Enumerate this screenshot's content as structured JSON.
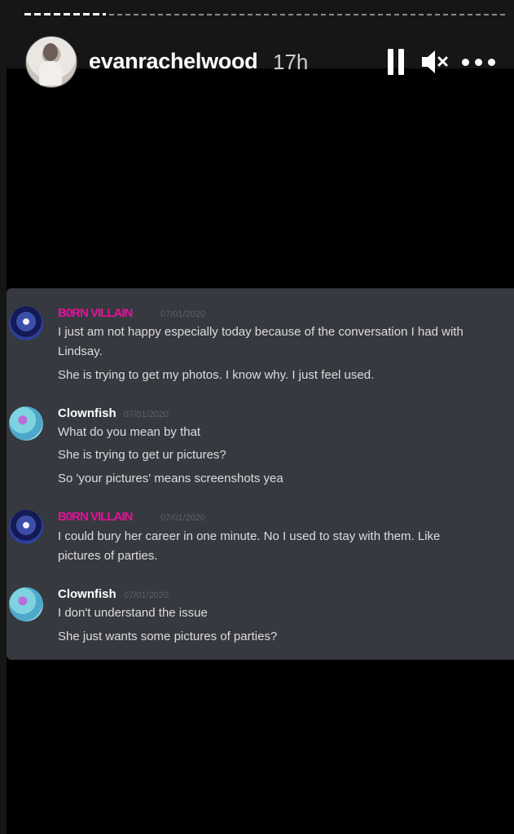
{
  "story": {
    "username": "evanrachelwood",
    "time_ago": "17h",
    "controls": {
      "pause": "pause-icon",
      "mute": "volume-muted-icon",
      "more": "more-icon"
    }
  },
  "discord": {
    "messages": [
      {
        "author": "B0RN VILLAIN",
        "timestamp": "07/01/2020",
        "lines": [
          "I just am not happy especially today because of the conversation I had with",
          "Lindsay.",
          "She is trying to get my photos. I know why. I just feel used."
        ]
      },
      {
        "author": "Clownfish",
        "timestamp": "07/01/2020",
        "lines": [
          "What do you mean by that",
          "She is trying to get ur pictures?",
          "So 'your pictures' means screenshots yea"
        ]
      },
      {
        "author": "B0RN VILLAIN",
        "timestamp": "07/01/2020",
        "lines": [
          "I could bury her career in one minute. No I used to stay with them. Like",
          "pictures of parties."
        ]
      },
      {
        "author": "Clownfish",
        "timestamp": "07/01/2020",
        "lines": [
          "I don't understand the issue",
          "She just wants some pictures of parties?"
        ]
      }
    ]
  },
  "colors": {
    "card_bg": "#36393f",
    "villain_name": "#e6109a",
    "message_text": "#dcddde"
  }
}
